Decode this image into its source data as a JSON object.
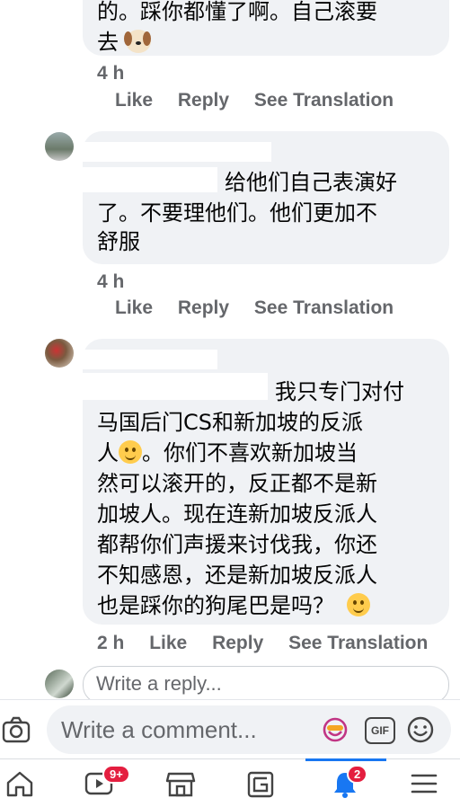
{
  "comments": [
    {
      "text_partial_top": "的。踩你都懂了啊。自己滚要",
      "text_end": "去",
      "time": "4 h",
      "actions": [
        "Like",
        "Reply",
        "See Translation"
      ]
    },
    {
      "text": "给他们自己表演好了。不要理他们。他们更加不舒服",
      "line1": "给他们自己表演好",
      "line2": "了。不要理他们。他们更加不",
      "line3": "舒服",
      "time": "4 h",
      "actions": [
        "Like",
        "Reply",
        "See Translation"
      ]
    },
    {
      "line1": "我只专门对付",
      "line2": "马国后门CS和新加坡的反派",
      "line3a": "人",
      "line3b": "。你们不喜欢新加坡当",
      "line4": "然可以滚开的，反正都不是新",
      "line5": "加坡人。现在连新加坡反派人",
      "line6": "都帮你们声援来讨伐我，你还",
      "line7": "不知感恩，还是新加坡反派人",
      "line8": "也是踩你的狗尾巴是吗？",
      "time": "2 h",
      "actions": [
        "Like",
        "Reply",
        "See Translation"
      ]
    }
  ],
  "reply_placeholder": "Write a reply...",
  "comment_placeholder": "Write a comment...",
  "gif_label": "GIF",
  "nav": {
    "video_badge": "9+",
    "notif_badge": "2"
  },
  "colors": {
    "bubble": "#f0f2f5",
    "accent": "#1877f2",
    "badge": "#e41e3f",
    "meta": "#65676b"
  }
}
